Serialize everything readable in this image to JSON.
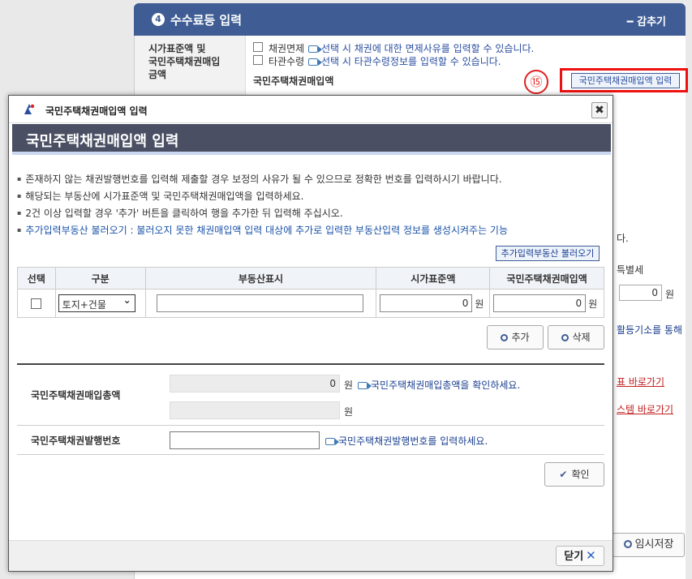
{
  "background": {
    "section_number": "4",
    "section_title": "수수료등 입력",
    "collapse_label": "━ 감추기",
    "row_label_line1": "시가표준액 및",
    "row_label_line2": "국민주택채권매입",
    "row_label_line3": "금액",
    "exempt_label": "채권면제",
    "exempt_hint": "선택 시 채권에 대한 면제사유를 입력할 수 있습니다.",
    "other_label": "타관수령",
    "other_hint": "선택 시 타관수령정보를 입력할 수 있습니다.",
    "purchase_amount_label": "국민주택채권매입액",
    "annotation_number": "⑮",
    "open_modal_button": "국민주택채권매입액 입력",
    "right_text_1": "다.",
    "right_text_2": "특별세",
    "right_input_value": "0",
    "right_unit": "원",
    "right_text_3": "활등기소를 통해",
    "right_link_1": "표 바로가기",
    "right_link_2": "스템 바로가기",
    "temp_save_button": "임시저장"
  },
  "modal": {
    "window_title": "국민주택채권매입액 입력",
    "close_symbol": "✖",
    "hero_title": "국민주택채권매입액 입력",
    "notes": [
      "존재하지 않는 채권발행번호를 입력해 제출할 경우 보정의 사유가 될 수 있으므로 정확한 번호를 입력하시기 바랍니다.",
      "해당되는 부동산에 시가표준액 및 국민주택채권매입액을 입력하세요.",
      "2건 이상 입력할 경우 '추가' 버튼을 클릭하여 행을 추가한 뒤 입력해 주십시오.",
      "추가입력부동산 불러오기 : 불러오지 못한 채권매입액 입력 대상에 추가로 입력한 부동산입력 정보를 생성시켜주는 기능"
    ],
    "load_button": "추가입력부동산 불러오기",
    "table": {
      "headers": [
        "선택",
        "구분",
        "부동산표시",
        "시가표준액",
        "국민주택채권매입액"
      ],
      "row": {
        "category": "토지+건물",
        "property": "",
        "standard_price": "0",
        "bond_amount": "0",
        "unit": "원"
      }
    },
    "add_button": "추가",
    "delete_button": "삭제",
    "summary": {
      "total_label": "국민주택채권매입총액",
      "total_value": "0",
      "total_unit": "원",
      "total_hint": "국민주택채권매입총액을 확인하세요.",
      "second_value": "",
      "second_unit": "원",
      "issue_label": "국민주택채권발행번호",
      "issue_hint": "국민주택채권발행번호를 입력하세요."
    },
    "confirm_button": "확인",
    "footer_close_button": "닫기"
  },
  "colors": {
    "header_blue": "#3f5d94",
    "hero_dark": "#4a4f63",
    "highlight_red": "#ee1111",
    "link_blue": "#1a52a8"
  }
}
